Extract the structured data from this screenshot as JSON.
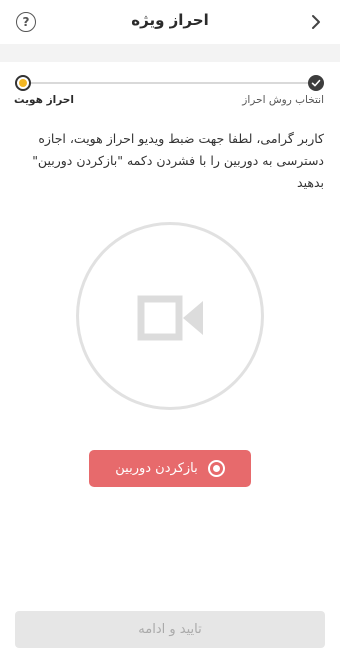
{
  "header": {
    "title": "احراز ویژه",
    "help_glyph": "?",
    "icons": {
      "help": "help-circle-icon",
      "back": "chevron-right-icon"
    }
  },
  "stepper": {
    "steps": [
      {
        "label": "انتخاب روش احراز",
        "status": "completed"
      },
      {
        "label": "احراز هویت",
        "status": "current"
      }
    ],
    "colors": {
      "completed": "#3d3d3d",
      "current_dot": "#f2b623",
      "line": "#d9d9d9"
    }
  },
  "instruction": "کاربر گرامی، لطفا جهت ضبط ویدیو احراز هویت، اجازه دسترسی به دوربین را با فشردن دکمه \"بازکردن دوربین\" بدهید",
  "camera_preview": {
    "icon": "video-camera-icon"
  },
  "open_camera_button": {
    "label": "بازکردن دوربین",
    "icon": "record-icon",
    "color": "#e76a6c"
  },
  "confirm_button": {
    "label": "تایید و ادامه",
    "disabled": true
  }
}
